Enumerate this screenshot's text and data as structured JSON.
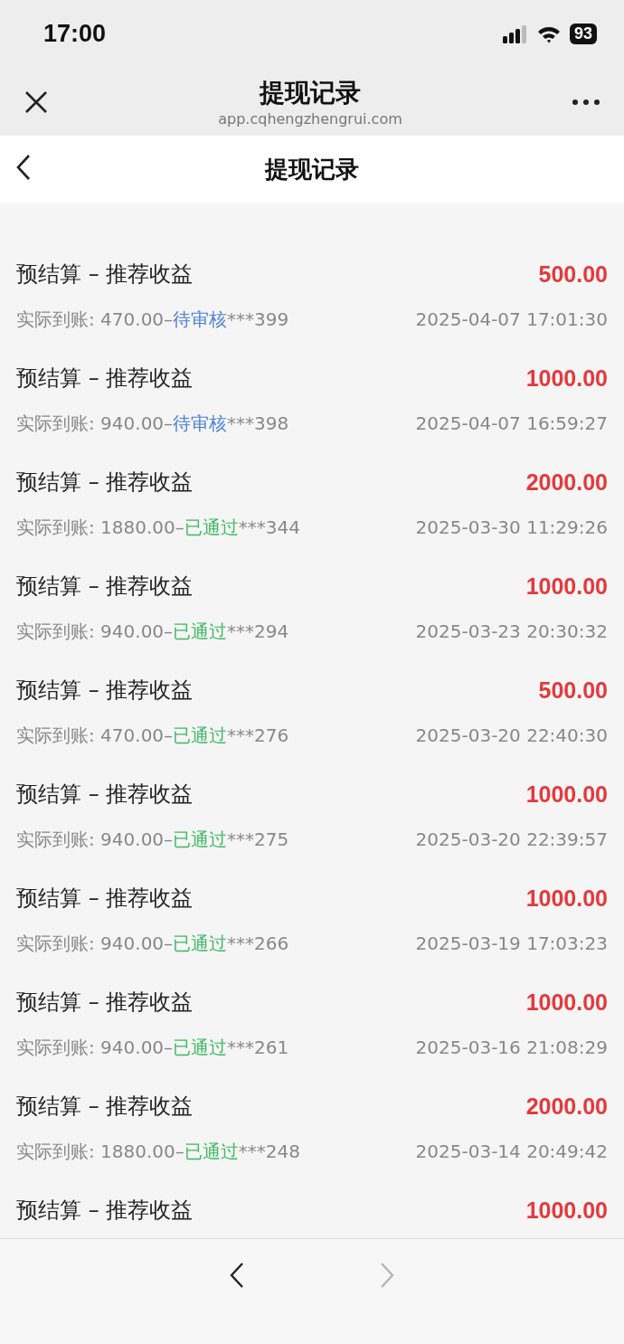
{
  "status_bar": {
    "time": "17:00",
    "battery": "93"
  },
  "browser_bar": {
    "title": "提现记录",
    "url": "app.cqhengzhengrui.com"
  },
  "header": {
    "title": "提现记录"
  },
  "records": [
    {
      "title": "预结算 – 推荐收益",
      "amount": "500.00",
      "detail": {
        "prefix": "实际到账: 470.00–",
        "status": "待审核",
        "kind": "pending",
        "suffix": "***399"
      },
      "time": "2025-04-07 17:01:30"
    },
    {
      "title": "预结算 – 推荐收益",
      "amount": "1000.00",
      "detail": {
        "prefix": "实际到账: 940.00–",
        "status": "待审核",
        "kind": "pending",
        "suffix": "***398"
      },
      "time": "2025-04-07 16:59:27"
    },
    {
      "title": "预结算 – 推荐收益",
      "amount": "2000.00",
      "detail": {
        "prefix": "实际到账: 1880.00–",
        "status": "已通过",
        "kind": "approved",
        "suffix": "***344"
      },
      "time": "2025-03-30 11:29:26"
    },
    {
      "title": "预结算 – 推荐收益",
      "amount": "1000.00",
      "detail": {
        "prefix": "实际到账: 940.00–",
        "status": "已通过",
        "kind": "approved",
        "suffix": "***294"
      },
      "time": "2025-03-23 20:30:32"
    },
    {
      "title": "预结算 – 推荐收益",
      "amount": "500.00",
      "detail": {
        "prefix": "实际到账: 470.00–",
        "status": "已通过",
        "kind": "approved",
        "suffix": "***276"
      },
      "time": "2025-03-20 22:40:30"
    },
    {
      "title": "预结算 – 推荐收益",
      "amount": "1000.00",
      "detail": {
        "prefix": "实际到账: 940.00–",
        "status": "已通过",
        "kind": "approved",
        "suffix": "***275"
      },
      "time": "2025-03-20 22:39:57"
    },
    {
      "title": "预结算 – 推荐收益",
      "amount": "1000.00",
      "detail": {
        "prefix": "实际到账: 940.00–",
        "status": "已通过",
        "kind": "approved",
        "suffix": "***266"
      },
      "time": "2025-03-19 17:03:23"
    },
    {
      "title": "预结算 – 推荐收益",
      "amount": "1000.00",
      "detail": {
        "prefix": "实际到账: 940.00–",
        "status": "已通过",
        "kind": "approved",
        "suffix": "***261"
      },
      "time": "2025-03-16 21:08:29"
    },
    {
      "title": "预结算 – 推荐收益",
      "amount": "2000.00",
      "detail": {
        "prefix": "实际到账: 1880.00–",
        "status": "已通过",
        "kind": "approved",
        "suffix": "***248"
      },
      "time": "2025-03-14 20:49:42"
    },
    {
      "title": "预结算 – 推荐收益",
      "amount": "1000.00"
    }
  ],
  "toolbar": {
    "back_disabled": false,
    "forward_disabled": true
  }
}
